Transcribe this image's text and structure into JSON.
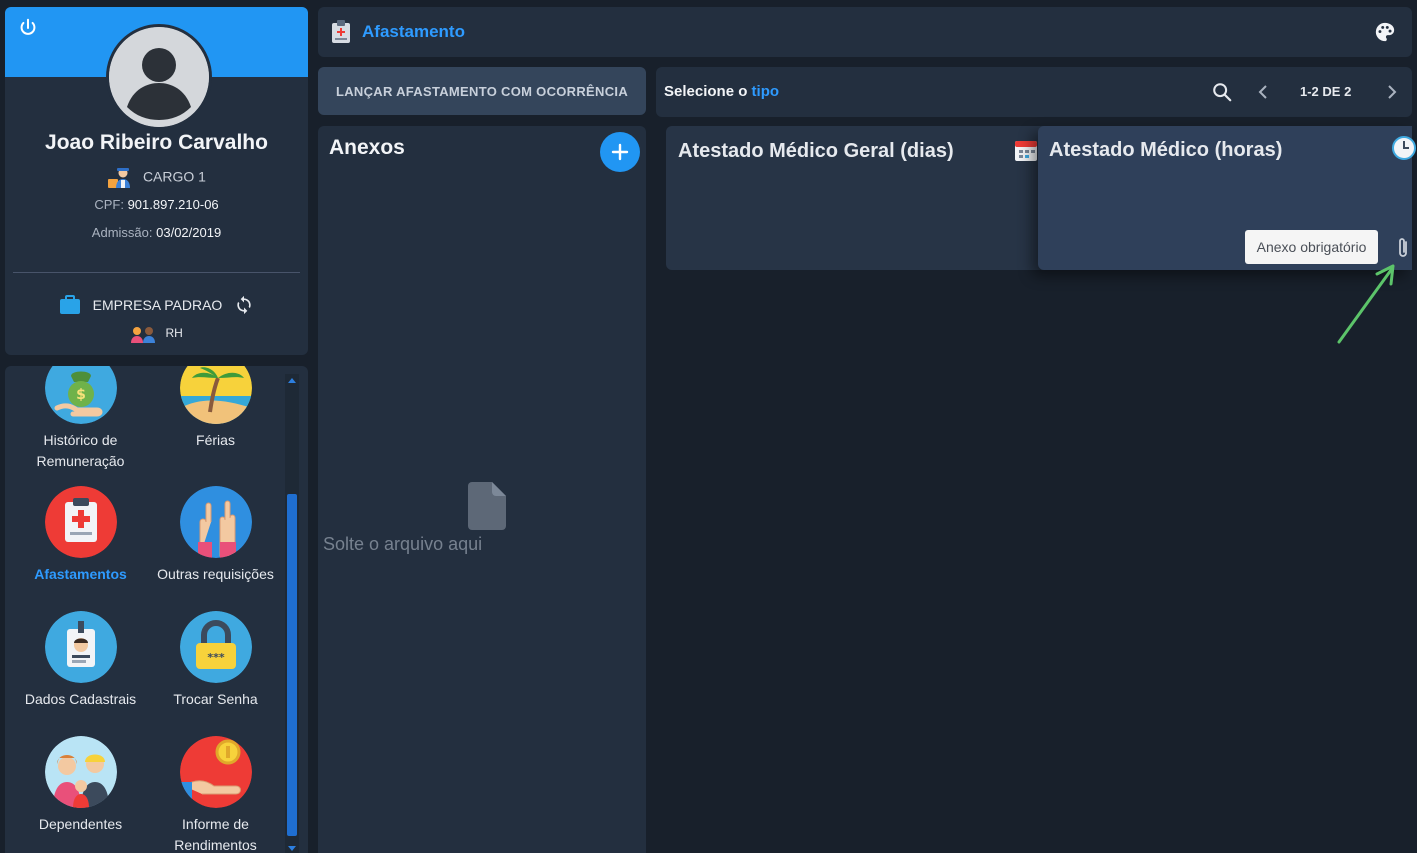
{
  "profile": {
    "name": "Joao Ribeiro Carvalho",
    "cargo": "CARGO 1",
    "cpf_label": "CPF:",
    "cpf_value": "901.897.210-06",
    "admissao_label": "Admissão:",
    "admissao_value": "03/02/2019",
    "empresa": "EMPRESA PADRAO",
    "departamento": "RH"
  },
  "menu": {
    "items": [
      {
        "label": "Histórico de Remuneração"
      },
      {
        "label": "Férias"
      },
      {
        "label": "Afastamentos"
      },
      {
        "label": "Outras requisições"
      },
      {
        "label": "Dados Cadastrais"
      },
      {
        "label": "Trocar Senha"
      },
      {
        "label": "Dependentes"
      },
      {
        "label": "Informe de Rendimentos"
      }
    ]
  },
  "header": {
    "title": "Afastamento"
  },
  "launch_button": "LANÇAR AFASTAMENTO COM OCORRÊNCIA",
  "select": {
    "label_prefix": "Selecione o",
    "label_accent": "tipo",
    "pagination": "1-2 DE 2"
  },
  "anexos": {
    "title": "Anexos",
    "drop_text": "Solte o arquivo aqui"
  },
  "types": [
    {
      "title": "Atestado Médico Geral (dias)"
    },
    {
      "title": "Atestado Médico (horas)",
      "badge": "Anexo obrigatório"
    }
  ],
  "colors": {
    "accent": "#2196f3",
    "link": "#2e9bff",
    "background": "#18202b",
    "panel": "#232f3f",
    "arrow": "#5cc46a"
  }
}
